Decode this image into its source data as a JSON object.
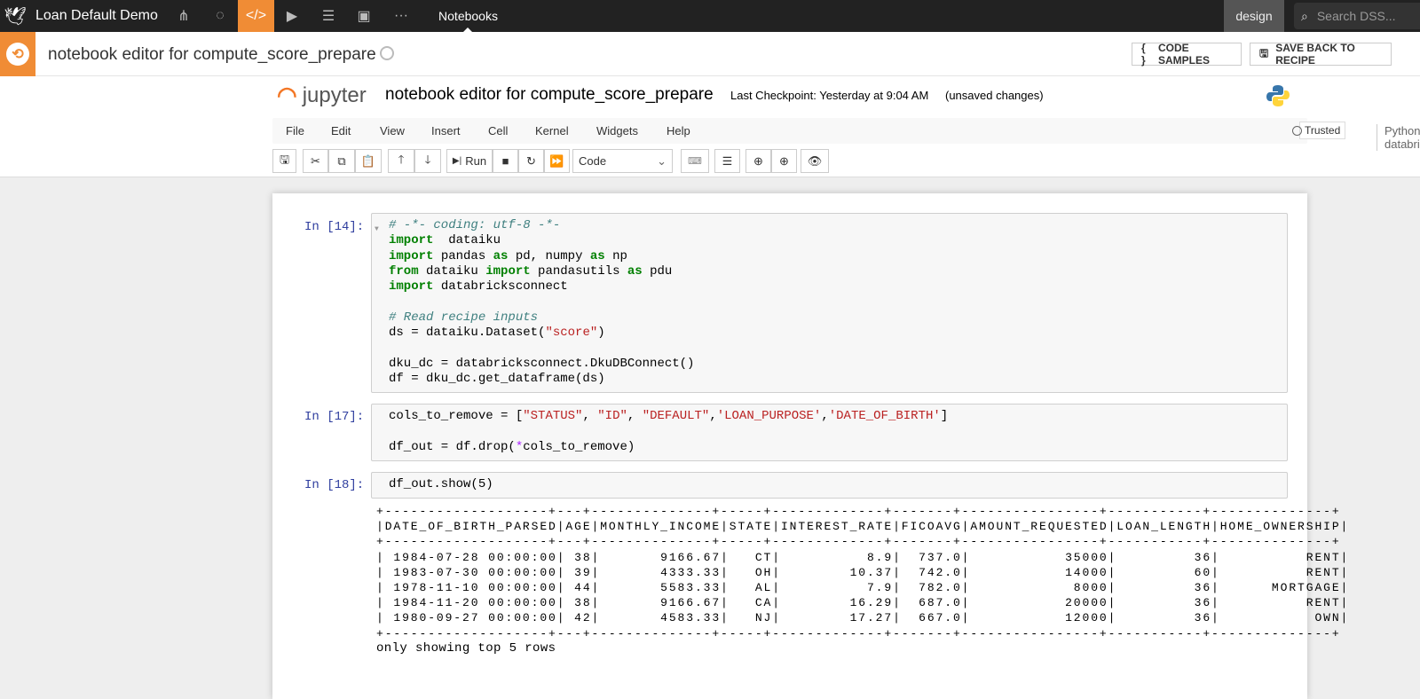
{
  "topbar": {
    "project": "Loan Default Demo",
    "tab": "Notebooks",
    "mode": "design",
    "search_placeholder": "Search DSS..."
  },
  "subbar": {
    "title": "notebook editor for compute_score_prepare",
    "code_samples": "CODE SAMPLES",
    "save_back": "SAVE BACK TO RECIPE"
  },
  "jupyter": {
    "logo": "jupyter",
    "title": "notebook editor for compute_score_prepare",
    "checkpoint": "Last Checkpoint: Yesterday at 9:04 AM",
    "dirty": "(unsaved changes)",
    "trusted": "Trusted",
    "kernel": "Python (env databricks_connect)"
  },
  "menu": [
    "File",
    "Edit",
    "View",
    "Insert",
    "Cell",
    "Kernel",
    "Widgets",
    "Help"
  ],
  "toolbar": {
    "run": "Run",
    "cell_type": "Code"
  },
  "cells": [
    {
      "prompt": "In [14]:",
      "lines": [
        [
          [
            "cm",
            "# -*- coding: utf-8 -*-"
          ]
        ],
        [
          [
            "kw",
            "import"
          ],
          [
            "",
            "  dataiku"
          ]
        ],
        [
          [
            "kw",
            "import"
          ],
          [
            "",
            " pandas "
          ],
          [
            "kw",
            "as"
          ],
          [
            "",
            " pd, numpy "
          ],
          [
            "kw",
            "as"
          ],
          [
            "",
            " np"
          ]
        ],
        [
          [
            "kw",
            "from"
          ],
          [
            "",
            " dataiku "
          ],
          [
            "kw",
            "import"
          ],
          [
            "",
            " pandasutils "
          ],
          [
            "kw",
            "as"
          ],
          [
            "",
            " pdu"
          ]
        ],
        [
          [
            "kw",
            "import"
          ],
          [
            "",
            " databricksconnect"
          ]
        ],
        [],
        [
          [
            "cm",
            "# Read recipe inputs"
          ]
        ],
        [
          [
            "",
            "ds = dataiku.Dataset("
          ],
          [
            "st",
            "\"score\""
          ],
          [
            "",
            ")"
          ]
        ],
        [],
        [
          [
            "",
            "dku_dc = databricksconnect.DkuDBConnect()"
          ]
        ],
        [
          [
            "",
            "df = dku_dc.get_dataframe(ds)"
          ]
        ]
      ]
    },
    {
      "prompt": "In [17]:",
      "lines": [
        [
          [
            "",
            "cols_to_remove = ["
          ],
          [
            "st",
            "\"STATUS\""
          ],
          [
            "",
            ", "
          ],
          [
            "st",
            "\"ID\""
          ],
          [
            "",
            ", "
          ],
          [
            "st",
            "\"DEFAULT\""
          ],
          [
            "",
            ","
          ],
          [
            "st",
            "'LOAN_PURPOSE'"
          ],
          [
            "",
            ","
          ],
          [
            "st",
            "'DATE_OF_BIRTH'"
          ],
          [
            "",
            "]"
          ]
        ],
        [],
        [
          [
            "",
            "df_out = df.drop("
          ],
          [
            "op",
            "*"
          ],
          [
            "",
            "cols_to_remove)"
          ]
        ]
      ]
    },
    {
      "prompt": "In [18]:",
      "lines": [
        [
          [
            "",
            "df_out.show(5)"
          ]
        ]
      ]
    }
  ],
  "output": {
    "lines": [
      "+-------------------+---+--------------+-----+-------------+-------+----------------+-----------+--------------+",
      "|DATE_OF_BIRTH_PARSED|AGE|MONTHLY_INCOME|STATE|INTEREST_RATE|FICOAVG|AMOUNT_REQUESTED|LOAN_LENGTH|HOME_OWNERSHIP|",
      "+-------------------+---+--------------+-----+-------------+-------+----------------+-----------+--------------+",
      "| 1984-07-28 00:00:00| 38|       9166.67|   CT|          8.9|  737.0|           35000|         36|          RENT|",
      "| 1983-07-30 00:00:00| 39|       4333.33|   OH|        10.37|  742.0|           14000|         60|          RENT|",
      "| 1978-11-10 00:00:00| 44|       5583.33|   AL|          7.9|  782.0|            8000|         36|      MORTGAGE|",
      "| 1984-11-20 00:00:00| 38|       9166.67|   CA|        16.29|  687.0|           20000|         36|          RENT|",
      "| 1980-09-27 00:00:00| 42|       4583.33|   NJ|        17.27|  667.0|           12000|         36|           OWN|",
      "+-------------------+---+--------------+-----+-------------+-------+----------------+-----------+--------------+"
    ],
    "footer": "only showing top 5 rows"
  }
}
